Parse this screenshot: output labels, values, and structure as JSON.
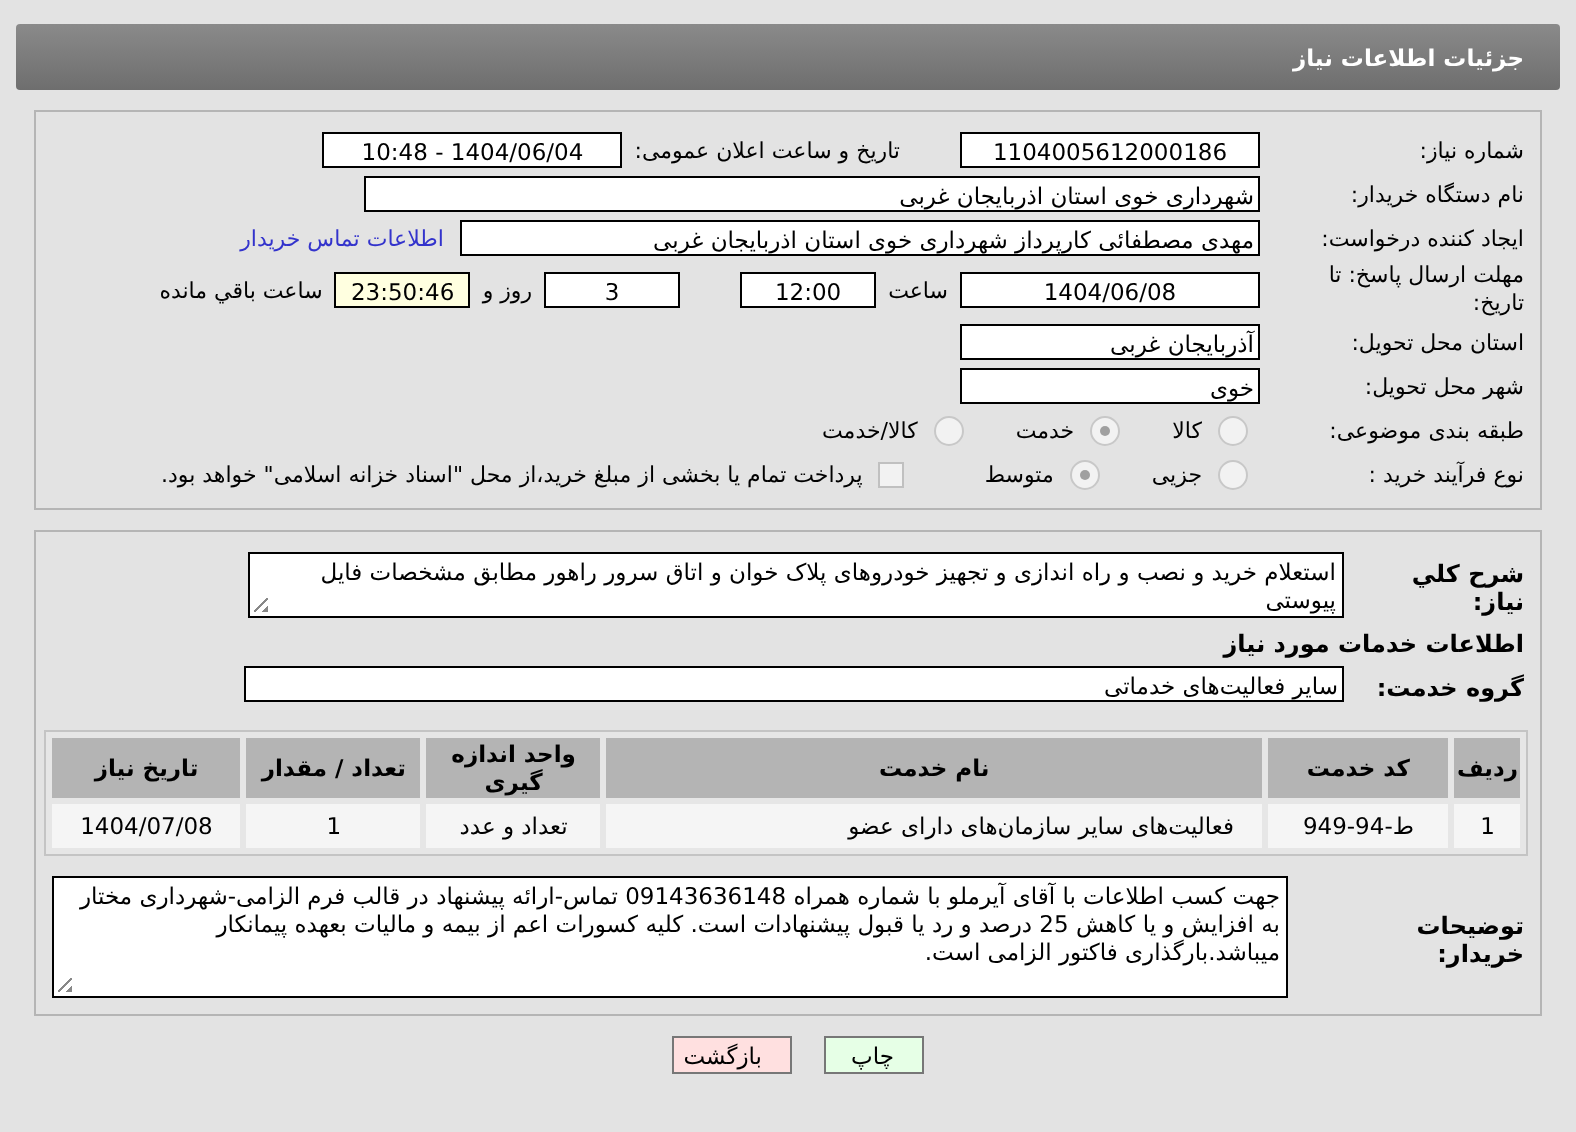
{
  "title": "جزئیات اطلاعات نیاز",
  "need_number": {
    "label": "شماره نیاز:",
    "value": "1104005612000186"
  },
  "announce": {
    "label": "تاریخ و ساعت اعلان عمومی:",
    "value": "1404/06/04 - 10:48"
  },
  "buyer": {
    "label": "نام دستگاه خریدار:",
    "value": "شهرداری خوی استان اذربایجان غربی"
  },
  "requester": {
    "label": "ایجاد کننده درخواست:",
    "value": "مهدی مصطفائی کارپرداز شهرداری خوی استان اذربایجان غربی",
    "link": "اطلاعات تماس خریدار"
  },
  "deadline": {
    "label": "مهلت ارسال پاسخ: تا تاریخ:",
    "date": "1404/06/08",
    "time_label": "ساعت",
    "time": "12:00",
    "days": "3",
    "days_label": "روز و",
    "remaining": "23:50:46",
    "remaining_label": "ساعت باقي مانده"
  },
  "province": {
    "label": "استان محل تحویل:",
    "value": "آذربایجان غربی"
  },
  "city": {
    "label": "شهر محل تحویل:",
    "value": "خوی"
  },
  "category": {
    "label": "طبقه بندی موضوعی:",
    "options": [
      {
        "label": "کالا",
        "selected": false
      },
      {
        "label": "خدمت",
        "selected": true
      },
      {
        "label": "کالا/خدمت",
        "selected": false
      }
    ]
  },
  "process": {
    "label": "نوع فرآیند خرید :",
    "options": [
      {
        "label": "جزیی",
        "selected": false
      },
      {
        "label": "متوسط",
        "selected": true
      }
    ],
    "payment": {
      "label": "پرداخت تمام یا بخشی از مبلغ خرید،از محل \"اسناد خزانه اسلامی\" خواهد بود.",
      "checked": false
    }
  },
  "description": {
    "label": "شرح کلي نیاز:",
    "value": "استعلام خرید و نصب و راه اندازی و تجهیز خودروهای پلاک خوان و اتاق سرور راهور مطابق مشخصات فایل پیوستی"
  },
  "services_heading": "اطلاعات خدمات مورد نیاز",
  "service_group": {
    "label": "گروه خدمت:",
    "value": "سایر فعالیت‌های خدماتی"
  },
  "table": {
    "columns": [
      "ردیف",
      "کد خدمت",
      "نام خدمت",
      "واحد اندازه گیری",
      "تعداد / مقدار",
      "تاریخ نیاز"
    ],
    "rows": [
      [
        "1",
        "ط-94-949",
        "فعالیت‌های سایر سازمان‌های دارای عضو",
        "تعداد و عدد",
        "1",
        "1404/07/08"
      ]
    ]
  },
  "buyer_notes": {
    "label": "توضیحات خریدار:",
    "value": "جهت کسب اطلاعات با آقای آیرملو با شماره همراه 09143636148 تماس-ارائه پیشنهاد در قالب فرم الزامی-شهرداری مختار به افزایش و یا کاهش 25 درصد و رد یا قبول پیشنهادات است. کلیه کسورات اعم از بیمه و مالیات بعهده پیمانکار میباشد.بارگذاری فاکتور الزامی است."
  },
  "buttons": [
    {
      "label": "چاپ",
      "kind": "print"
    },
    {
      "label": "بازگشت",
      "kind": "back"
    }
  ]
}
